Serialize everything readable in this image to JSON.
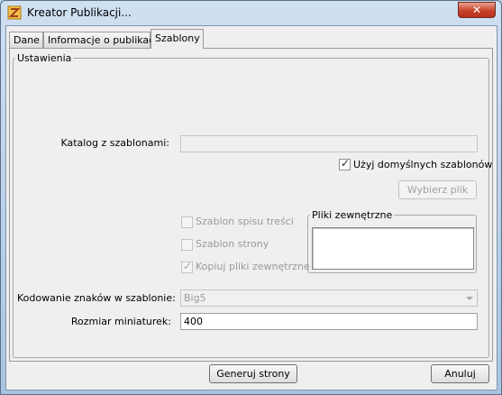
{
  "window": {
    "title": "Kreator Publikacji..."
  },
  "close_button": {
    "label": "✕"
  },
  "tabs": [
    {
      "label": "Dane"
    },
    {
      "label": "Informacje o publikacji"
    },
    {
      "label": "Szablony"
    }
  ],
  "settings": {
    "legend": "Ustawienia",
    "template_dir": {
      "label": "Katalog z szablonami:",
      "value": ""
    },
    "use_default_templates": {
      "label": "Użyj domyślnych szablonów",
      "checked": true
    },
    "choose_file_button": "Wybierz plik",
    "toc_template": {
      "label": "Szablon spisu treści",
      "checked": false
    },
    "page_template": {
      "label": "Szablon strony",
      "checked": false
    },
    "copy_external": {
      "label": "Kopiuj pliki zewnętrzne",
      "checked": true
    },
    "external_files": {
      "legend": "Pliki zewnętrzne"
    },
    "encoding": {
      "label": "Kodowanie znaków w szablonie:",
      "value": "Big5"
    },
    "thumb_size": {
      "label": "Rozmiar miniaturek:",
      "value": "400"
    }
  },
  "footer": {
    "generate_button": "Generuj strony",
    "cancel_button": "Anuluj"
  }
}
